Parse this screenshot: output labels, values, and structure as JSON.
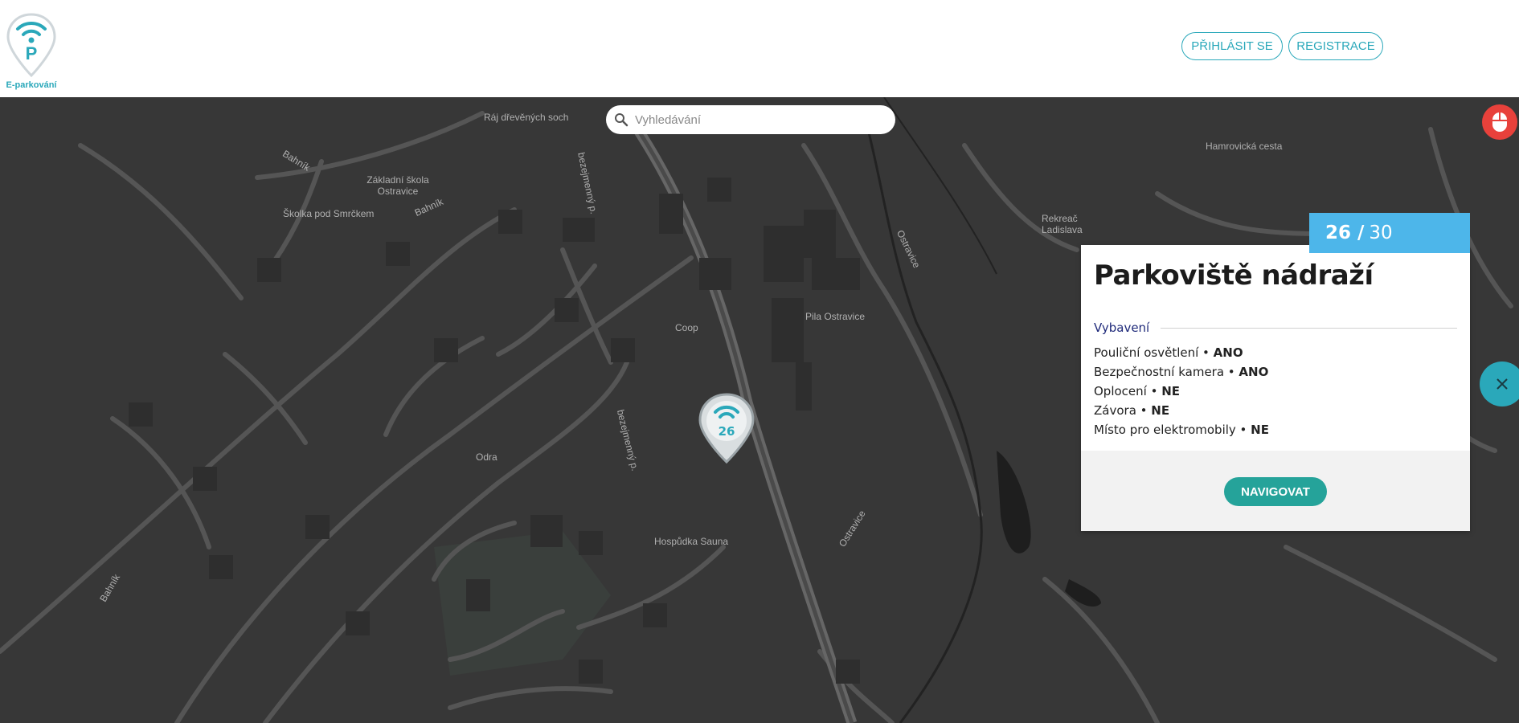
{
  "header": {
    "logo_text": "E-parkování",
    "login_label": "PŘIHLÁSIT SE",
    "register_label": "REGISTRACE",
    "accent_color": "#2aa8ba"
  },
  "search": {
    "placeholder": "Vyhledávání",
    "icon": "search-icon"
  },
  "map": {
    "background_color": "#373737",
    "labels": [
      "Ráj dřevěných soch",
      "Bahník",
      "Základní škola Ostravice",
      "Školka pod Smrčkem",
      "Bahník",
      "bezejmenný p.",
      "Coop",
      "Pila Ostravice",
      "Ostravice",
      "Hamrovická cesta",
      "Rekreač Ladislava",
      "bezejmenný p.",
      "Odra",
      "Hospůdka Sauna",
      "Ostravice",
      "Bahník"
    ],
    "marker": {
      "count": "26",
      "icon": "parking-pin-icon"
    }
  },
  "popup": {
    "available": "26 /",
    "total": "30",
    "capacity_color": "#4db6ea",
    "title": "Parkoviště nádraží",
    "section_title": "Vybavení",
    "equipment": [
      {
        "label": "Pouliční osvětlení • ",
        "value": "ANO"
      },
      {
        "label": "Bezpečnostní kamera • ",
        "value": "ANO"
      },
      {
        "label": "Oplocení • ",
        "value": "NE"
      },
      {
        "label": "Závora • ",
        "value": "NE"
      },
      {
        "label": "Místo pro elektromobily • ",
        "value": "NE"
      }
    ],
    "navigate_label": "NAVIGOVAT",
    "navigate_color": "#25a39a"
  },
  "controls": {
    "mouse_icon": "mouse-icon",
    "mouse_color": "#e8413b",
    "close_icon": "close-icon"
  }
}
